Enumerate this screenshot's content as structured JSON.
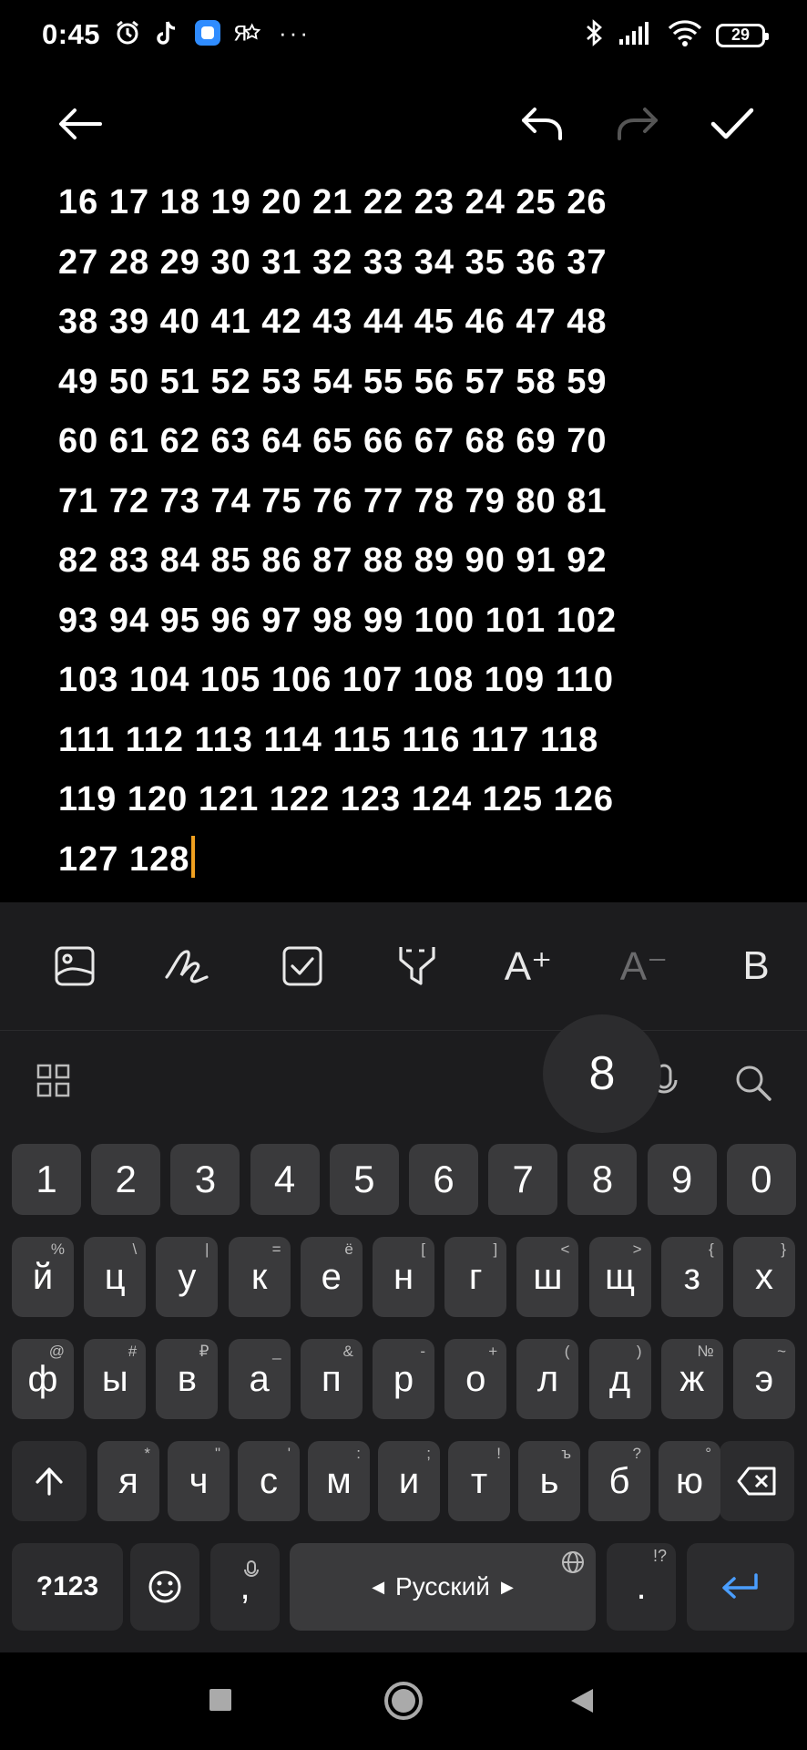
{
  "status": {
    "time": "0:45",
    "left_icons": [
      "alarm-icon",
      "tiktok-icon",
      "app-icon",
      "yandex-icon"
    ],
    "more": "···",
    "battery": "29"
  },
  "content": {
    "lines": [
      "16 17 18 19 20 21 22 23 24 25 26",
      "27 28 29 30 31 32 33 34 35 36 37",
      "38 39 40 41 42 43 44 45 46 47 48",
      "49 50 51 52 53 54 55 56 57 58 59",
      "60 61 62 63 64 65 66 67 68 69 70",
      "71 72 73 74 75 76 77 78 79 80 81",
      "82 83 84 85 86 87 88 89 90 91 92",
      "93 94 95 96 97 98 99 100 101 102",
      "103 104 105 106 107 108 109 110",
      "111 112 113 114 115 116 117 118",
      "119 120 121 122 123 124 125 126",
      "127 128"
    ]
  },
  "format_toolbar": {
    "font_increase": "A⁺",
    "font_decrease": "A⁻",
    "bold": "B"
  },
  "keyboard": {
    "popup": "8",
    "numbers": [
      "1",
      "2",
      "3",
      "4",
      "5",
      "6",
      "7",
      "8",
      "9",
      "0"
    ],
    "row1": [
      {
        "k": "й",
        "h": "%"
      },
      {
        "k": "ц",
        "h": "\\"
      },
      {
        "k": "у",
        "h": "|"
      },
      {
        "k": "к",
        "h": "="
      },
      {
        "k": "е",
        "h": "ё"
      },
      {
        "k": "н",
        "h": "["
      },
      {
        "k": "г",
        "h": "]"
      },
      {
        "k": "ш",
        "h": "<"
      },
      {
        "k": "щ",
        "h": ">"
      },
      {
        "k": "з",
        "h": "{"
      },
      {
        "k": "х",
        "h": "}"
      }
    ],
    "row2": [
      {
        "k": "ф",
        "h": "@"
      },
      {
        "k": "ы",
        "h": "#"
      },
      {
        "k": "в",
        "h": "₽"
      },
      {
        "k": "а",
        "h": "_"
      },
      {
        "k": "п",
        "h": "&"
      },
      {
        "k": "р",
        "h": "-"
      },
      {
        "k": "о",
        "h": "+"
      },
      {
        "k": "л",
        "h": "("
      },
      {
        "k": "д",
        "h": ")"
      },
      {
        "k": "ж",
        "h": "№"
      },
      {
        "k": "э",
        "h": "~"
      }
    ],
    "row3": [
      {
        "k": "я",
        "h": "*"
      },
      {
        "k": "ч",
        "h": "\""
      },
      {
        "k": "с",
        "h": "'"
      },
      {
        "k": "м",
        "h": ":"
      },
      {
        "k": "и",
        "h": ";"
      },
      {
        "k": "т",
        "h": "!"
      },
      {
        "k": "ь",
        "h": "ъ"
      },
      {
        "k": "б",
        "h": "?"
      },
      {
        "k": "ю",
        "h": "°"
      }
    ],
    "symbols_label": "?123",
    "comma": ",",
    "space_label": "Русский",
    "period": ".",
    "period_hint": "!?"
  },
  "colors": {
    "cursor": "#f0a020",
    "enter": "#4a9eff"
  }
}
